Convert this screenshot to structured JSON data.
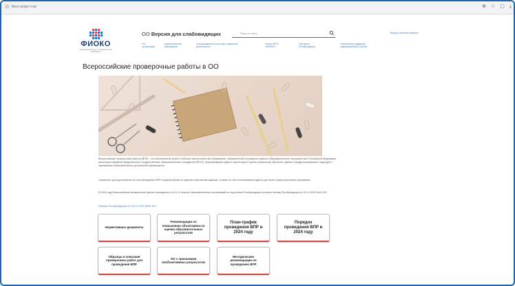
{
  "browser": {
    "url": "fioco.ru/vpr-v-oo",
    "icons": [
      "tune-icon",
      "zoom-icon",
      "star-icon",
      "extensions-icon",
      "download-icon"
    ]
  },
  "logo": {
    "text": "ФИОКО",
    "subtitle": "федеральный институт оценки качества образования"
  },
  "header": {
    "version_prefix": "OO",
    "version_label": "Версия для слабовидящих",
    "search_placeholder": "Поиск по сайту",
    "login": "Вход в личный кабинет"
  },
  "nav": [
    {
      "line1": "ОО",
      "line2": "организации"
    },
    {
      "line1": "Оценка качества",
      "line2": "образования"
    },
    {
      "line1": "Сопровождение контрольно-надзорной",
      "line2": "деятельности"
    },
    {
      "line1": "Услуги ФГБУ",
      "line2": "«ФИОКО»"
    },
    {
      "line1": "Call-центр",
      "line2": "Рособрнадзора"
    },
    {
      "line1": "Техническая поддержка",
      "line2": "информационных систем"
    }
  ],
  "page": {
    "title": "Всероссийские проверочные работы в ОО",
    "para1": "Всероссийские проверочные работы (ВПР) – это комплексный проект в области оценки качества образования, направленный на развитие единого образовательного пространства в Российской Федерации, мониторинг введения федеральных государственных образовательных стандартов (ФГОС), формирование единых ориентиров в оценке результатов обучения, единых стандартизированных подходов к оцениванию образовательных достижений обучающихся.",
    "para2": "Указанные цели достигаются за счет проведения ВПР в едином время по единым комплектам заданий, а также за счет использования единых для всей страны критериев оценивания.",
    "para3": "В 2024 году Всероссийские проверочные работы проводятся в 4-8 и 11 классах образовательных организаций по поручению Рособрнадзора согласно письму Рособрнадзора от 04.12.2023 №02-422.",
    "link": "Письмо Рособрнадзора от 04.12.2023 №02-422"
  },
  "cards": [
    {
      "label": "Нормативные документы",
      "big": false
    },
    {
      "label": "Рекомендации по повышению объективности оценки образовательных результатов",
      "big": false
    },
    {
      "label": "План-график проведения ВПР в 2024 году",
      "big": true
    },
    {
      "label": "Порядок проведения ВПР в 2024 году",
      "big": true
    },
    {
      "label": "Образцы и описания проверочных работ для проведения ВПР",
      "big": false
    },
    {
      "label": "ОО с признаками необъективных результатов",
      "big": false
    },
    {
      "label": "Методические рекомендации по проведению ВПР",
      "big": false
    }
  ]
}
